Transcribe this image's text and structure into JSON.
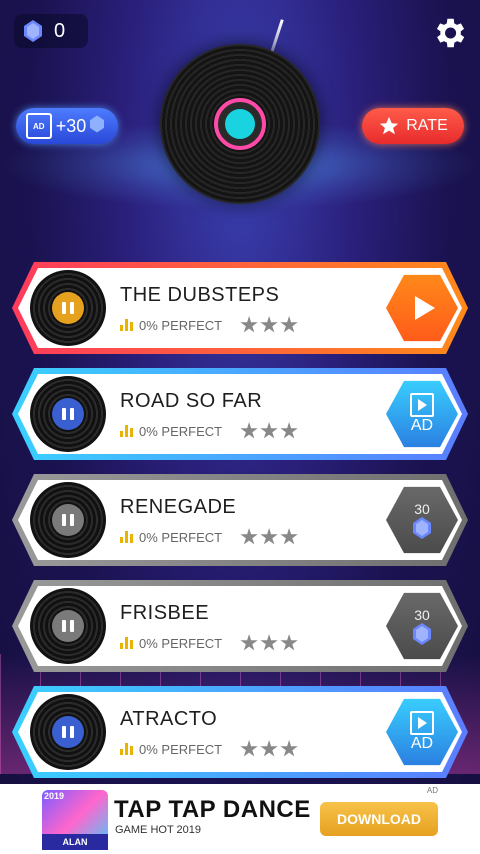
{
  "header": {
    "gem_count": "0",
    "ad_reward": "+30",
    "rate_label": "RATE",
    "ad_icon_text": "AD"
  },
  "songs": [
    {
      "title": "THE DUBSTEPS",
      "progress": "0%",
      "perfect_label": "PERFECT",
      "action": "play",
      "action_label": "",
      "price": "",
      "theme": "orange"
    },
    {
      "title": "ROAD SO FAR",
      "progress": "0%",
      "perfect_label": "PERFECT",
      "action": "ad",
      "action_label": "AD",
      "price": "",
      "theme": "blue"
    },
    {
      "title": "RENEGADE",
      "progress": "0%",
      "perfect_label": "PERFECT",
      "action": "gems",
      "action_label": "",
      "price": "30",
      "theme": "gray"
    },
    {
      "title": "FRISBEE",
      "progress": "0%",
      "perfect_label": "PERFECT",
      "action": "gems",
      "action_label": "",
      "price": "30",
      "theme": "gray"
    },
    {
      "title": "ATRACTO",
      "progress": "0%",
      "perfect_label": "PERFECT",
      "action": "ad",
      "action_label": "AD",
      "price": "",
      "theme": "blue"
    }
  ],
  "banner": {
    "title": "TAP TAP DANCE",
    "subtitle": "GAME HOT 2019",
    "button": "DOWNLOAD",
    "icon_caption": "ALAN WALKER",
    "icon_year": "2019",
    "ad_tag": "AD"
  },
  "colors": {
    "orange": "#ff7a1a",
    "blue": "#3ad0ff",
    "gray": "#8a8a8a"
  }
}
